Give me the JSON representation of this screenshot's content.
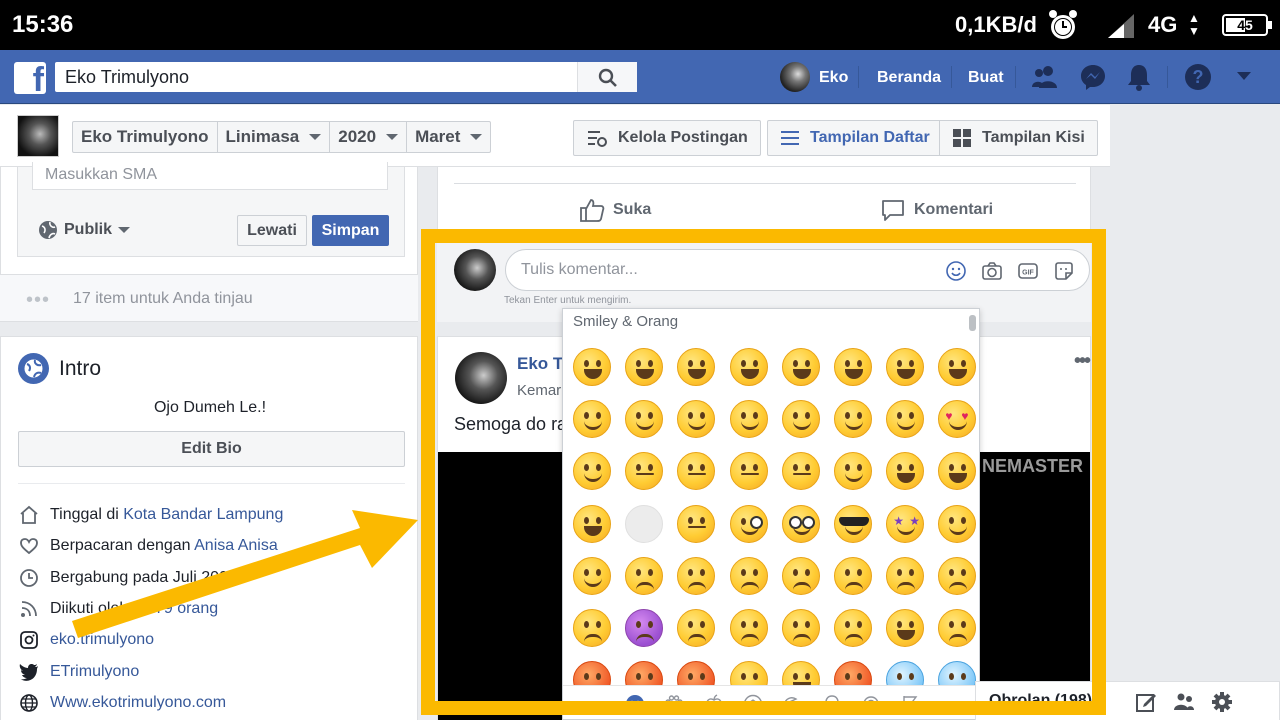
{
  "status_bar": {
    "time": "15:36",
    "speed": "0,1KB/d",
    "network": "4G",
    "battery": "45"
  },
  "topbar": {
    "search_value": "Eko Trimulyono",
    "user_name": "Eko",
    "home_label": "Beranda",
    "create_label": "Buat",
    "brand_color": "#4267b2"
  },
  "profile_header": {
    "breadcrumbs": [
      "Eko Trimulyono",
      "Linimasa",
      "2020",
      "Maret"
    ],
    "manage_posts": "Kelola Postingan",
    "list_view": "Tampilan Daftar",
    "grid_view": "Tampilan Kisi"
  },
  "left": {
    "sma_placeholder": "Masukkan SMA",
    "privacy": "Publik",
    "skip": "Lewati",
    "save": "Simpan",
    "review": "17 item untuk Anda tinjau",
    "intro_title": "Intro",
    "bio": "Ojo Dumeh Le.!",
    "edit_bio": "Edit Bio",
    "rows": {
      "lives_prefix": "Tinggal di",
      "lives_place": "Kota Bandar Lampung",
      "relationship_prefix": "Berpacaran dengan",
      "relationship_name": "Anisa Anisa",
      "joined": "Bergabung pada Juli 2007",
      "followed_prefix": "Diikuti oleh",
      "followed_count": "5.279 orang",
      "instagram": "eko.trimulyono",
      "twitter": "ETrimulyono",
      "website": "Www.ekotrimulyono.com"
    }
  },
  "post": {
    "like": "Suka",
    "comment": "Komentari",
    "comment_placeholder": "Tulis komentar...",
    "enter_hint": "Tekan Enter untuk mengirim.",
    "post2_name": "Eko T",
    "post2_sub": "Kemar",
    "post2_text": "Semoga do ra",
    "video_text": "NEMASTER",
    "more": "•••"
  },
  "emoji_picker": {
    "category": "Smiley & Orang",
    "highlight_color": "#fbb900"
  },
  "chat": {
    "label": "Obrolan (198)"
  }
}
